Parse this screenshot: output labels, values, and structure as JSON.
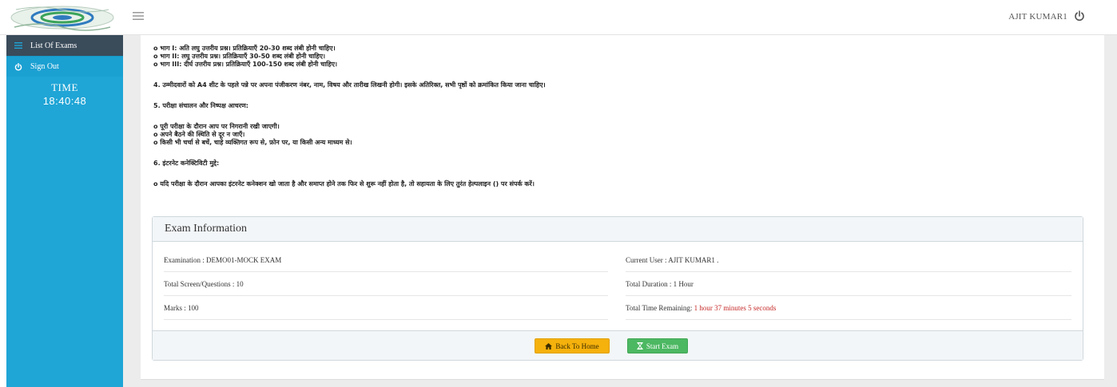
{
  "header": {
    "user_name": "AJIT KUMAR1"
  },
  "sidebar": {
    "items": [
      {
        "label": "List Of Exams",
        "icon": "list-icon"
      },
      {
        "label": "Sign Out",
        "icon": "power-icon"
      }
    ],
    "time_label": "TIME",
    "time_value": "18:40:48"
  },
  "instructions": {
    "part1": "o भाग I: अति लघु उत्तरीय प्रश्न। प्रतिक्रियाएँ 20-30 शब्द लंबी होनी चाहिए।",
    "part2": "o भाग II: लघु उत्तरीय प्रश्न। प्रतिक्रियाएँ 30-50 शब्द लंबी होनी चाहिए।",
    "part3": "o भाग III: दीर्घ उत्तरीय प्रश्न। प्रतिक्रियाएँ 100-150 शब्द लंबी होनी चाहिए।",
    "point4": "4. उम्मीदवारों को A4 शीट के पहले पन्ने पर अपना पंजीकरण नंबर, नाम, विषय और तारीख लिखनी होगी। इसके अतिरिक्त, सभी पृष्ठों को क्रमांकित किया जाना चाहिए।",
    "point5_heading": "5. परीक्षा संचालन और निष्पक्ष आचरण:",
    "point5_b1": "o पूरी परीक्षा के दौरान आप पर निगरानी रखी जाएगी।",
    "point5_b2": "o अपने बैठने की स्थिति से दूर न जाएँ।",
    "point5_b3": "o किसी भी चर्चा से बचें, चाहे व्यक्तिगत रूप से, फ़ोन पर, या किसी अन्य माध्यम से।",
    "point6_heading": "6. इंटरनेट कनेक्टिविटी मुद्दे:",
    "point6_b1": "o यदि परीक्षा के दौरान आपका इंटरनेट कनेक्शन खो जाता है और समाप्त होने तक फिर से शुरू नहीं होता है, तो सहायता के लिए तुरंत हेल्पलाइन () पर संपर्क करें।"
  },
  "exam_info": {
    "title": "Exam Information",
    "examination": "Examination : DEMO01-MOCK EXAM",
    "current_user": "Current User : AJIT KUMAR1 .",
    "total_questions": "Total Screen/Questions : 10",
    "total_duration": "Total Duration : 1 Hour",
    "marks": "Marks : 100",
    "time_remaining_label": "Total Time Remaining: ",
    "time_remaining_value": "1 hour 37 minutes 5 seconds"
  },
  "buttons": {
    "back_home": "Back To Home",
    "start_exam": "Start Exam"
  },
  "colors": {
    "sidebar": "#1fa5d6",
    "active_item": "#3a4b5a",
    "warning_button": "#f5b10c",
    "success_button": "#4cb862",
    "time_remaining": "#c62828"
  }
}
